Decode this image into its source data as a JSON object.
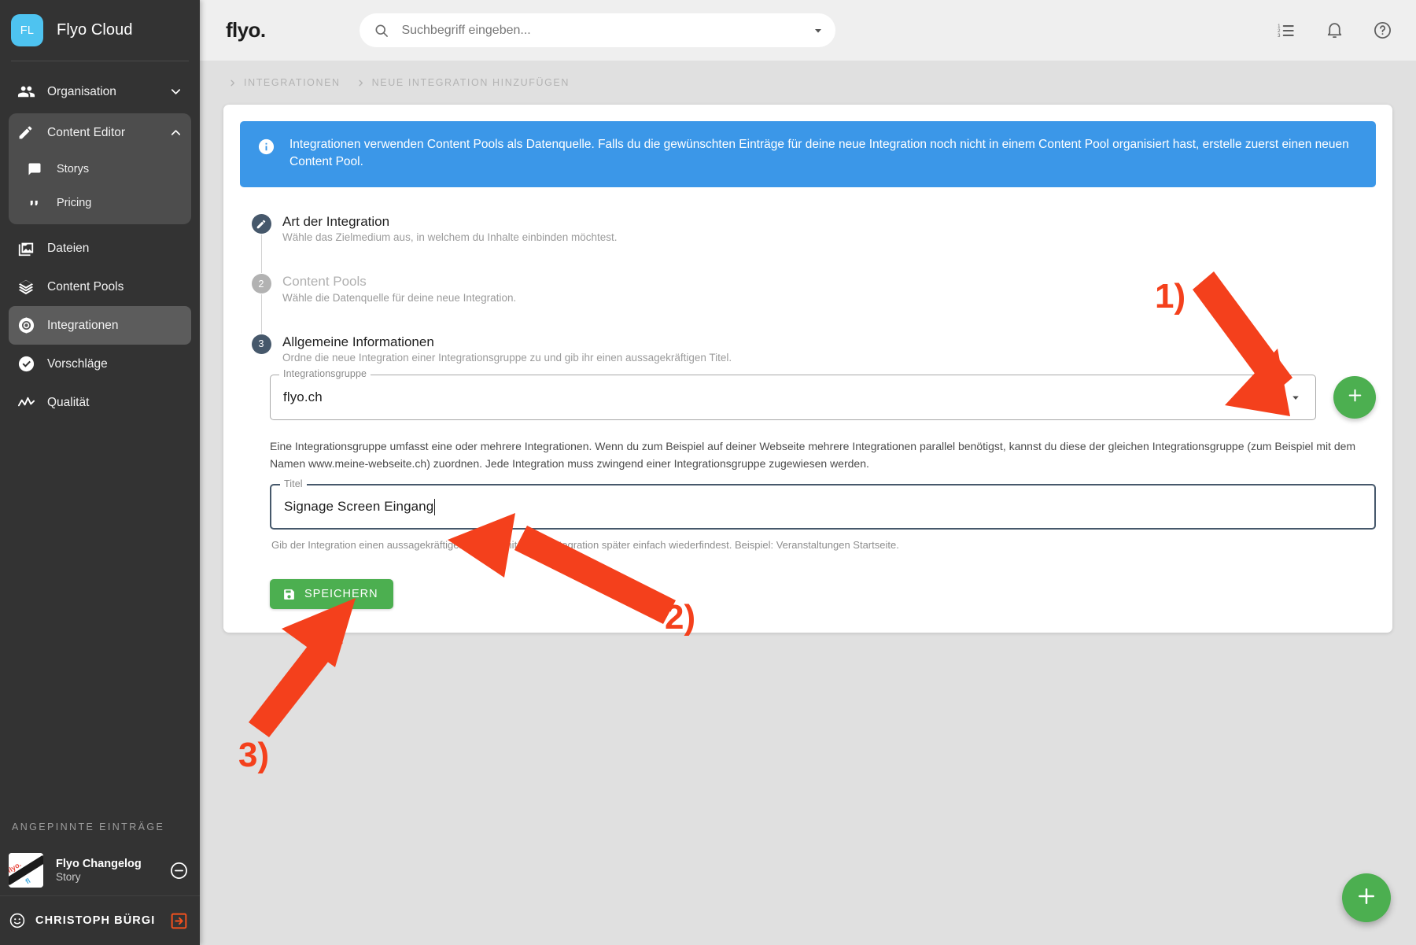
{
  "sidebar": {
    "brand": {
      "initials": "FL",
      "name": "Flyo Cloud"
    },
    "items": [
      {
        "label": "Organisation",
        "icon": "people-icon",
        "chevron": "chevron-down-icon"
      },
      {
        "label": "Content Editor",
        "icon": "pencil-icon",
        "chevron": "chevron-up-icon"
      },
      {
        "label": "Storys",
        "icon": "comment-icon"
      },
      {
        "label": "Pricing",
        "icon": "quote-icon"
      },
      {
        "label": "Dateien",
        "icon": "photo-library-icon"
      },
      {
        "label": "Content Pools",
        "icon": "layers-icon"
      },
      {
        "label": "Integrationen",
        "icon": "integration-icon"
      },
      {
        "label": "Vorschläge",
        "icon": "check-circle-icon"
      },
      {
        "label": "Qualität",
        "icon": "analytics-icon"
      }
    ],
    "pinned_title": "ANGEPINNTE EINTRÄGE",
    "pinned": [
      {
        "title": "Flyo Changelog",
        "subtitle": "Story",
        "remove_icon": "minus-circle-icon"
      }
    ],
    "user": {
      "name": "CHRISTOPH BÜRGI",
      "avatar_icon": "account-icon",
      "logout_icon": "logout-icon"
    }
  },
  "topbar": {
    "logo": "flyo.",
    "search": {
      "placeholder": "Suchbegriff eingeben...",
      "value": "",
      "icon": "search-icon",
      "caret_icon": "chevron-down-icon"
    },
    "icons": [
      {
        "name": "numbered-list-icon"
      },
      {
        "name": "bell-icon"
      },
      {
        "name": "help-circle-icon"
      }
    ]
  },
  "breadcrumb": [
    {
      "label": "INTEGRATIONEN"
    },
    {
      "label": "NEUE INTEGRATION HINZUFÜGEN"
    }
  ],
  "banner": {
    "icon": "info-icon",
    "text": "Integrationen verwenden Content Pools als Datenquelle. Falls du die gewünschten Einträge für deine neue Integration noch nicht in einem Content Pool organisiert hast, erstelle zuerst einen neuen Content Pool.",
    "color": "#3b97e8"
  },
  "steps": [
    {
      "marker": "pencil-icon",
      "state": "done",
      "title": "Art der Integration",
      "desc": "Wähle das Zielmedium aus, in welchem du Inhalte einbinden möchtest."
    },
    {
      "marker": "2",
      "state": "todo",
      "title": "Content Pools",
      "desc": "Wähle die Datenquelle für deine neue Integration."
    },
    {
      "marker": "3",
      "state": "current",
      "title": "Allgemeine Informationen",
      "desc": "Ordne die neue Integration einer Integrationsgruppe zu und gib ihr einen aussagekräftigen Titel."
    }
  ],
  "form": {
    "group_field": {
      "label": "Integrationsgruppe",
      "value": "flyo.ch",
      "dropdown_icon": "triangle-down-icon"
    },
    "add_group_button": {
      "icon": "plus-icon",
      "color": "#4caf50"
    },
    "group_help": "Eine Integrationsgruppe umfasst eine oder mehrere Integrationen. Wenn du zum Beispiel auf deiner Webseite mehrere Integrationen parallel benötigst, kannst du diese der gleichen Integrationsgruppe (zum Beispiel mit dem Namen www.meine-webseite.ch) zuordnen. Jede Integration muss zwingend einer Integrationsgruppe zugewiesen werden.",
    "title_field": {
      "label": "Titel",
      "value": "Signage Screen Eingang",
      "focused": true
    },
    "title_help": "Gib der Integration einen aussagekräftigen Titel, damit du die Integration später einfach wiederfindest. Beispiel: Veranstaltungen Startseite.",
    "save_button": {
      "label": "SPEICHERN",
      "icon": "save-icon",
      "color": "#4caf50"
    }
  },
  "fab": {
    "icon": "plus-icon",
    "color": "#4caf50"
  },
  "annotations": [
    {
      "number": "1)",
      "color": "#f4401c"
    },
    {
      "number": "2)",
      "color": "#f4401c"
    },
    {
      "number": "3)",
      "color": "#f4401c"
    }
  ]
}
